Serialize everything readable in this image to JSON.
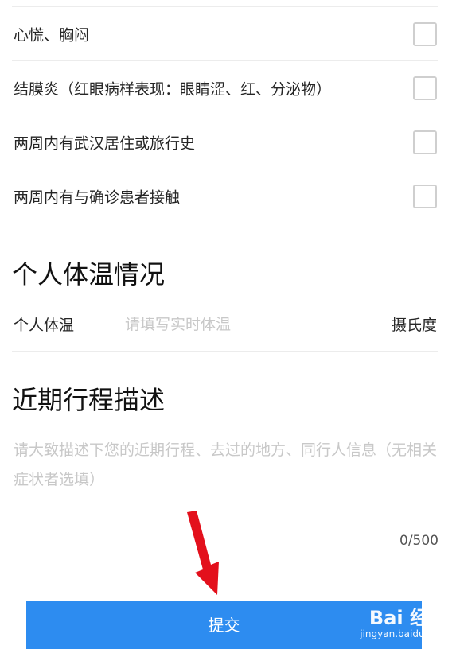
{
  "symptoms": [
    {
      "label": "心慌、胸闷",
      "checked": false
    },
    {
      "label": "结膜炎（红眼病样表现：眼睛涩、红、分泌物）",
      "checked": false
    },
    {
      "label": "两周内有武汉居住或旅行史",
      "checked": false
    },
    {
      "label": "两周内有与确诊患者接触",
      "checked": false
    }
  ],
  "temperature_section": {
    "title": "个人体温情况",
    "label": "个人体温",
    "placeholder": "请填写实时体温",
    "unit": "摄氏度"
  },
  "itinerary_section": {
    "title": "近期行程描述",
    "placeholder": "请大致描述下您的近期行程、去过的地方、同行人信息（无相关症状者选填）",
    "counter": "0/500"
  },
  "submit_label": "提交",
  "watermark": {
    "brand": "Bai 经验",
    "url": "jingyan.baidu.com"
  },
  "colors": {
    "accent": "#2d8cf0",
    "arrow": "#e3101c"
  }
}
